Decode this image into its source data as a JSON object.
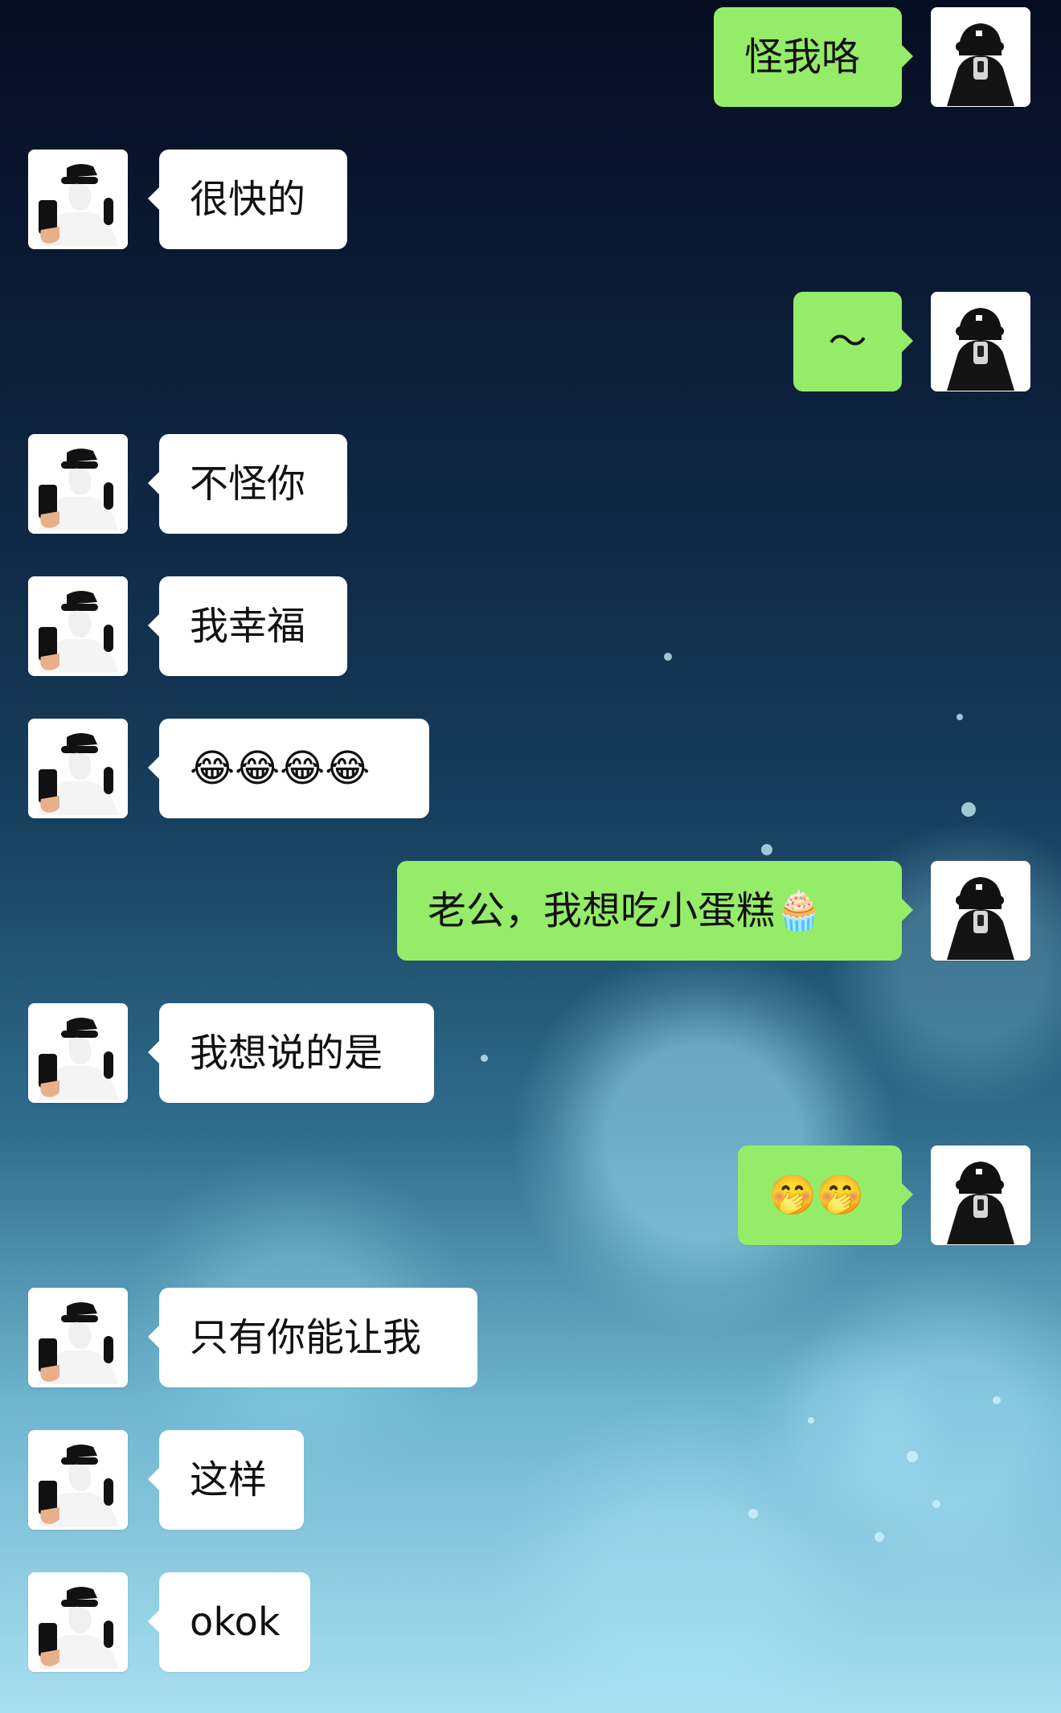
{
  "chat": {
    "messages": [
      {
        "side": "outgoing",
        "text": "怪我咯"
      },
      {
        "side": "incoming",
        "text": "很快的"
      },
      {
        "side": "outgoing",
        "text": "～"
      },
      {
        "side": "incoming",
        "text": "不怪你"
      },
      {
        "side": "incoming",
        "text": "我幸福"
      },
      {
        "side": "incoming",
        "text": "😂😂😂😂"
      },
      {
        "side": "outgoing",
        "text": "老公，我想吃小蛋糕🧁"
      },
      {
        "side": "incoming",
        "text": "我想说的是"
      },
      {
        "side": "outgoing",
        "text": "🤭🤭"
      },
      {
        "side": "incoming",
        "text": "只有你能让我"
      },
      {
        "side": "incoming",
        "text": "这样"
      },
      {
        "side": "incoming",
        "text": "okok"
      }
    ]
  },
  "colors": {
    "outgoing_bubble": "#95ec69",
    "incoming_bubble": "#ffffff"
  },
  "icons": {
    "incoming_avatar": "user-avatar-with-phone",
    "outgoing_avatar": "user-avatar-with-cap-and-phone"
  }
}
